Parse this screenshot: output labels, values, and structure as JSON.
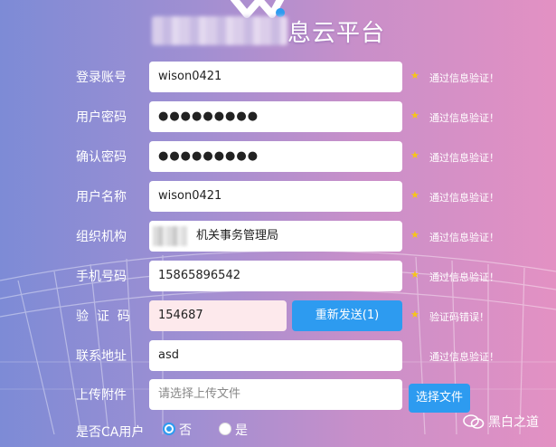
{
  "header": {
    "title_suffix": "息云平台"
  },
  "form": {
    "rows": [
      {
        "label": "登录账号",
        "value": "wison0421",
        "hint": "通过信息验证！"
      },
      {
        "label": "用户密码",
        "value": "●●●●●●●●●",
        "hint": "通过信息验证！"
      },
      {
        "label": "确认密码",
        "value": "●●●●●●●●●",
        "hint": "通过信息验证！"
      },
      {
        "label": "用户名称",
        "value": "wison0421",
        "hint": "通过信息验证！"
      },
      {
        "label": "组织机构",
        "value": "机关事务管理局",
        "hint": "通过信息验证！"
      },
      {
        "label": "手机号码",
        "value": "15865896542",
        "hint": "通过信息验证！"
      },
      {
        "label": "验  证  码",
        "value": "154687",
        "hint": "验证码错误！"
      },
      {
        "label": "联系地址",
        "value": "asd",
        "hint": "通过信息验证！"
      },
      {
        "label": "上传附件",
        "placeholder": "请选择上传文件"
      }
    ],
    "star": "★",
    "resend_button": "重新发送(1)",
    "choose_file_button": "选择文件",
    "ca_label": "是否CA用户",
    "ca_options": [
      "否",
      "是"
    ]
  },
  "watermark": {
    "text": "黑白之道",
    "icon": "wechat-icon"
  },
  "colors": {
    "accent": "#2d9bf0",
    "star": "#f5c518",
    "error_input_bg": "#fde9ec"
  }
}
